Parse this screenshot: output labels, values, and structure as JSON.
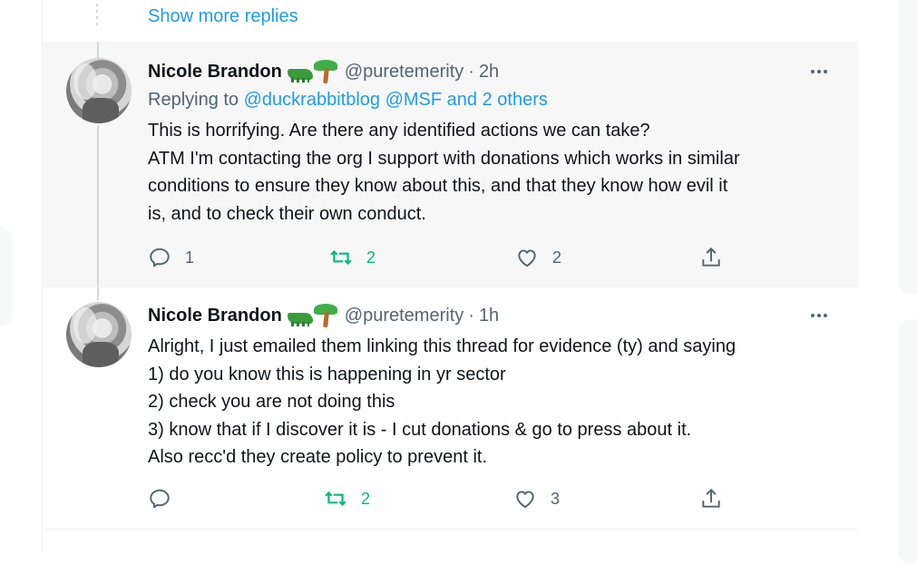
{
  "thread": {
    "show_more_label": "Show more replies"
  },
  "tweets": [
    {
      "author": {
        "name": "Nicole Brandon",
        "emoji": [
          "crocodile-emoji",
          "palm-tree-emoji"
        ],
        "handle": "@puretemerity"
      },
      "separator": "·",
      "time": "2h",
      "replying": {
        "prefix": "Replying to",
        "mention_1": "@duckrabbitblog",
        "mention_2": "@MSF",
        "others": "and 2 others"
      },
      "lines": [
        "This is horrifying. Are there any identified actions we can take?",
        "ATM I'm contacting the org I support with donations which works in similar",
        "conditions to ensure they know about this, and that they know how evil it",
        "is, and to check their own conduct."
      ],
      "stats": {
        "replies": "1",
        "retweets": "2",
        "likes": "2"
      }
    },
    {
      "author": {
        "name": "Nicole Brandon",
        "emoji": [
          "crocodile-emoji",
          "palm-tree-emoji"
        ],
        "handle": "@puretemerity"
      },
      "separator": "·",
      "time": "1h",
      "lines": [
        "Alright, I just emailed them linking this thread for evidence (ty) and saying",
        "1) do you know this is happening in yr sector",
        "2) check you are not doing this",
        "3) know that if I discover it is - I cut donations & go to press about it.",
        "Also recc'd they create policy to prevent it."
      ],
      "stats": {
        "replies": "",
        "retweets": "2",
        "likes": "3"
      }
    }
  ],
  "colors": {
    "link": "#1d9bf0",
    "muted": "#536471",
    "retweet_active": "#00ba7c",
    "highlight_bg": "#f7f7f7"
  }
}
